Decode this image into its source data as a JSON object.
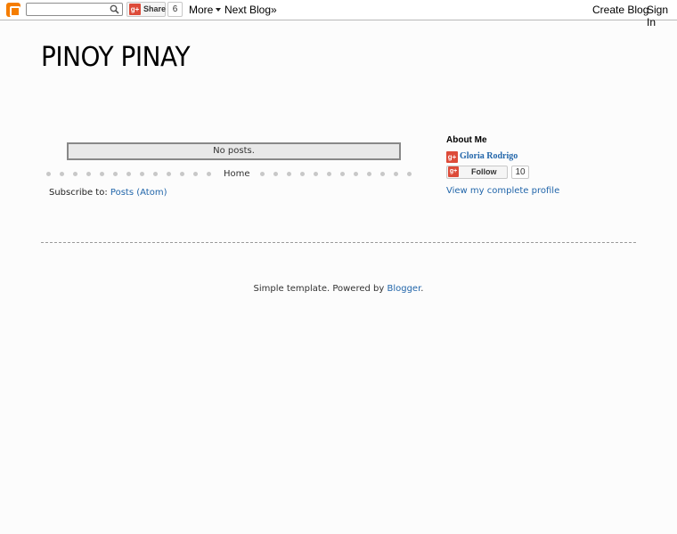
{
  "navbar": {
    "search_placeholder": "",
    "share_label": "Share",
    "share_count": "6",
    "more_label": "More",
    "next_blog_label": "Next Blog»",
    "create_blog_label": "Create Blog",
    "sign_in_label": "Sign In",
    "gplus_glyph": "g+"
  },
  "header": {
    "title": "PINOY PINAY"
  },
  "main": {
    "no_posts_text": "No posts.",
    "home_label": "Home",
    "subscribe_prefix": "Subscribe to: ",
    "subscribe_link": "Posts (Atom)"
  },
  "sidebar": {
    "about_title": "About Me",
    "profile_name": "Gloria Rodrigo",
    "follow_label": "Follow",
    "follow_count": "10",
    "view_profile_label": "View my complete profile"
  },
  "footer": {
    "attribution_prefix": "Simple template. Powered by ",
    "attribution_link": "Blogger",
    "attribution_suffix": "."
  },
  "colors": {
    "link": "#2266aa",
    "blogger_orange": "#f57d00",
    "gplus_red": "#dd4b39"
  }
}
